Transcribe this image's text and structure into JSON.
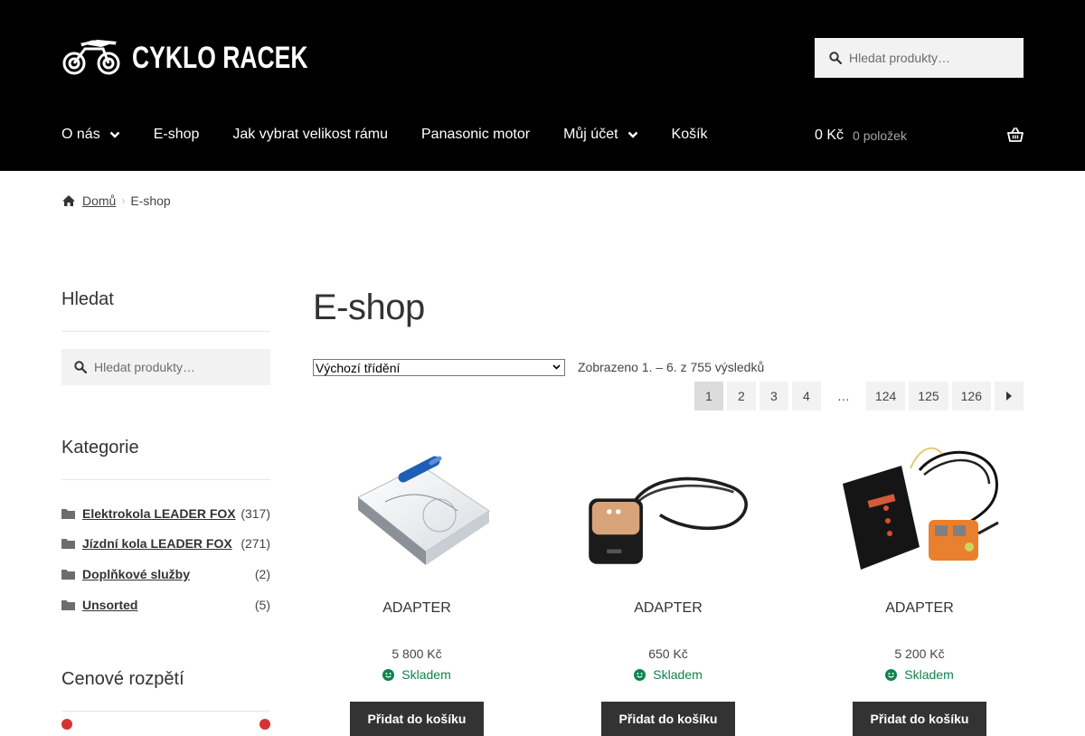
{
  "header": {
    "logo_text": "CYKLO RACEK",
    "search_placeholder": "Hledat produkty…",
    "nav": [
      {
        "label": "O nás",
        "has_dropdown": true
      },
      {
        "label": "E-shop",
        "has_dropdown": false
      },
      {
        "label": "Jak vybrat velikost rámu",
        "has_dropdown": false
      },
      {
        "label": "Panasonic motor",
        "has_dropdown": false
      },
      {
        "label": "Můj účet",
        "has_dropdown": true
      },
      {
        "label": "Košík",
        "has_dropdown": false
      }
    ],
    "cart": {
      "amount": "0 Kč",
      "count": "0 položek"
    }
  },
  "breadcrumb": {
    "home": "Domů",
    "current": "E-shop"
  },
  "sidebar": {
    "search_title": "Hledat",
    "search_placeholder": "Hledat produkty…",
    "categories_title": "Kategorie",
    "categories": [
      {
        "name": "Elektrokola LEADER FOX",
        "count": "(317)"
      },
      {
        "name": "Jízdní kola LEADER FOX",
        "count": "(271)"
      },
      {
        "name": "Doplňkové služby",
        "count": "(2)"
      },
      {
        "name": "Unsorted",
        "count": "(5)"
      }
    ],
    "price_title": "Cenové rozpětí"
  },
  "main": {
    "title": "E-shop",
    "orderby": "Výchozí třídění",
    "result_count": "Zobrazeno 1. – 6. z 755 výsledků",
    "pagination": [
      "1",
      "2",
      "3",
      "4",
      "…",
      "124",
      "125",
      "126"
    ],
    "current_page": "1",
    "products": [
      {
        "title": "ADAPTER",
        "price": "5 800 Kč",
        "stock": "Skladem",
        "button": "Přidat do košíku"
      },
      {
        "title": "ADAPTER",
        "price": "650 Kč",
        "stock": "Skladem",
        "button": "Přidat do košíku"
      },
      {
        "title": "ADAPTER",
        "price": "5 200 Kč",
        "stock": "Skladem",
        "button": "Přidat do košíku"
      }
    ]
  },
  "colors": {
    "header_bg": "#000000",
    "button_bg": "#333333",
    "stock_green": "#0f834d",
    "slider_handle": "#d63434"
  },
  "icons": [
    "bike-logo-icon",
    "search-icon",
    "chevron-down-icon",
    "basket-icon",
    "home-icon",
    "folder-icon",
    "smile-icon",
    "arrow-right-icon"
  ]
}
